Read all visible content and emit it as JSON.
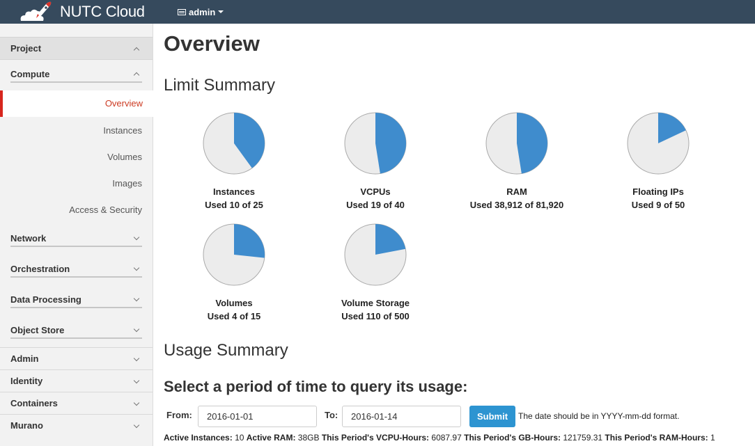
{
  "brand": {
    "name": "NUTC Cloud"
  },
  "topbar": {
    "user_menu": "admin"
  },
  "sidebar": {
    "project": "Project",
    "compute": "Compute",
    "compute_items": [
      "Overview",
      "Instances",
      "Volumes",
      "Images",
      "Access & Security"
    ],
    "active_item": "Overview",
    "groups": [
      "Network",
      "Orchestration",
      "Data Processing",
      "Object Store"
    ],
    "dashboards": [
      "Admin",
      "Identity",
      "Containers",
      "Murano"
    ]
  },
  "main": {
    "title": "Overview",
    "limit_heading": "Limit Summary",
    "usage_heading": "Usage Summary",
    "period_heading": "Select a period of time to query its usage:"
  },
  "limits": [
    {
      "name": "Instances",
      "used": 10,
      "total": 25,
      "label": "Used 10 of 25"
    },
    {
      "name": "VCPUs",
      "used": 19,
      "total": 40,
      "label": "Used 19 of 40"
    },
    {
      "name": "RAM",
      "used": 38912,
      "total": 81920,
      "label": "Used 38,912 of 81,920"
    },
    {
      "name": "Floating IPs",
      "used": 9,
      "total": 50,
      "label": "Used 9 of 50"
    },
    {
      "name": "Volumes",
      "used": 4,
      "total": 15,
      "label": "Used 4 of 15"
    },
    {
      "name": "Volume Storage",
      "used": 110,
      "total": 500,
      "label": "Used 110 of 500"
    }
  ],
  "colors": {
    "used": "#3f8ccd",
    "free": "#ececec",
    "stroke": "#aaaaaa",
    "topbar": "#364a5d",
    "active": "#d7261e"
  },
  "form": {
    "from_label": "From:",
    "from_value": "2016-01-01",
    "to_label": "To:",
    "to_value": "2016-01-14",
    "submit_label": "Submit",
    "hint": "The date should be in YYYY-mm-dd format."
  },
  "usage_stats": [
    {
      "label": "Active Instances:",
      "value": "10"
    },
    {
      "label": "Active RAM:",
      "value": "38GB"
    },
    {
      "label": "This Period's VCPU-Hours:",
      "value": "6087.97"
    },
    {
      "label": "This Period's GB-Hours:",
      "value": "121759.31"
    },
    {
      "label": "This Period's RAM-Hours:",
      "value": "1"
    }
  ]
}
